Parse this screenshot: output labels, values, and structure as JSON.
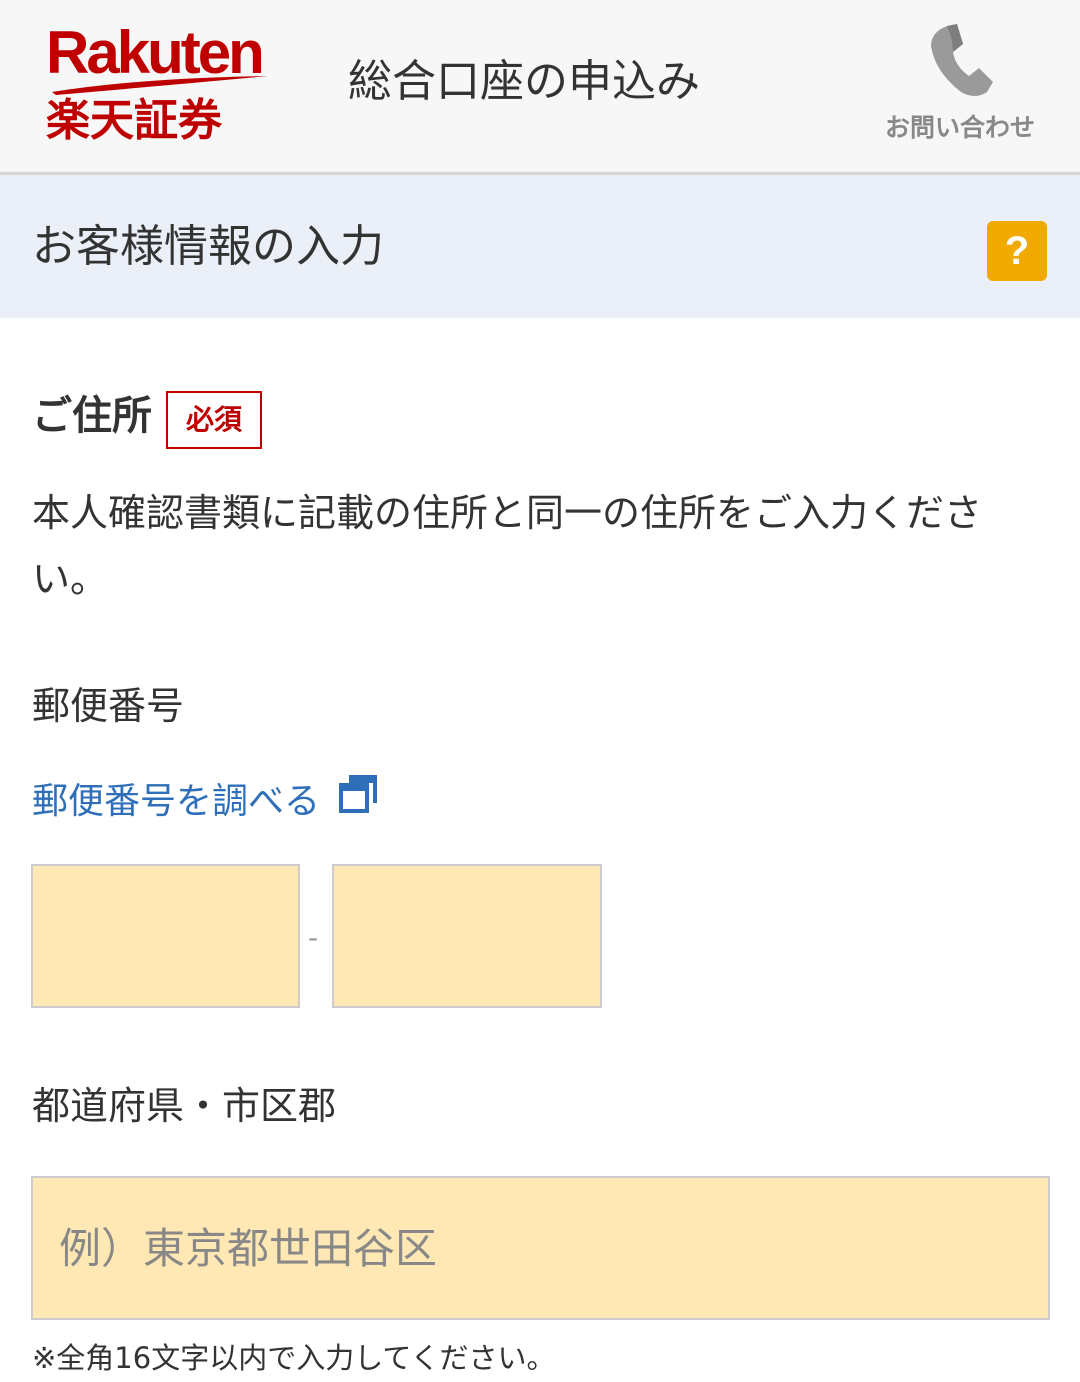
{
  "header": {
    "logo_en": "Rakuten",
    "logo_jp": "楽天証券",
    "title": "総合口座の申込み",
    "contact_label": "お問い合わせ",
    "contact_icon": "phone-icon",
    "brand_color": "#bf0000"
  },
  "section": {
    "title": "お客様情報の入力",
    "help_label": "?",
    "help_color": "#f0aa00"
  },
  "address": {
    "label": "ご住所",
    "required_badge": "必須",
    "description": "本人確認書類に記載の住所と同一の住所をご入力ください。"
  },
  "postal": {
    "label": "郵便番号",
    "lookup_link": "郵便番号を調べる",
    "lookup_icon": "external-window-icon",
    "separator": "-",
    "first_value": "",
    "second_value": ""
  },
  "prefecture": {
    "label": "都道府県・市区郡",
    "placeholder": "例）東京都世田谷区",
    "value": "",
    "note": "※全角16文字以内で入力してください。"
  },
  "colors": {
    "input_bg": "#ffe8b3",
    "link": "#2f6fba",
    "banner_bg": "#ebeff7"
  }
}
